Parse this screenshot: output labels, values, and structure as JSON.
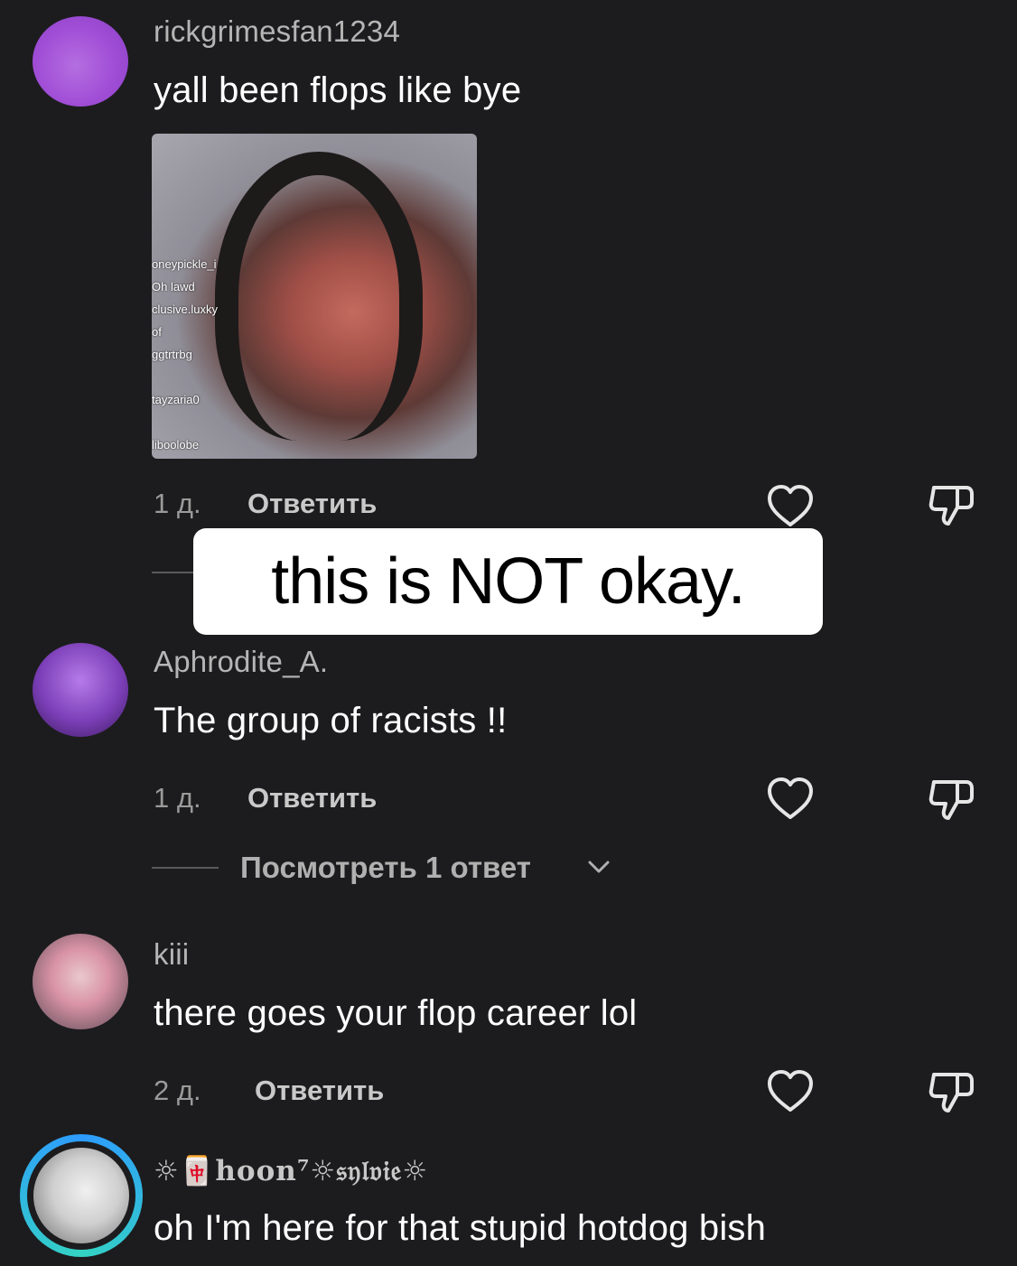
{
  "comments": [
    {
      "username": "rickgrimesfan1234",
      "text": "yall been flops like bye",
      "age": "1 д.",
      "reply_label": "Ответить",
      "attachment": {
        "overlay_lines": [
          "oneypickle_i",
          "Oh lawd",
          "clusive.luxky",
          "of",
          "ggtrtrbg",
          "",
          "tayzaria0",
          "",
          "liboolobe"
        ]
      }
    },
    {
      "username": "Aphrodite_A.",
      "text": "The group of racists !!",
      "age": "1 д.",
      "reply_label": "Ответить",
      "view_replies": "Посмотреть 1 ответ"
    },
    {
      "username": "kiii",
      "text": "there goes your flop career lol",
      "age": "2 д.",
      "reply_label": "Ответить"
    },
    {
      "username": "☼🀄hoon⁷☼𝔰𝔶𝔩𝔳𝔦𝔢☼",
      "text": "oh I'm here for that stupid hotdog bish"
    }
  ],
  "caption": "this is NOT okay.",
  "icons": {
    "like": "heart-outline-icon",
    "dislike": "thumbs-down-outline-icon",
    "expand": "chevron-down-icon"
  },
  "colors": {
    "background": "#1c1c1e",
    "story_ring": "#2e9bff"
  }
}
